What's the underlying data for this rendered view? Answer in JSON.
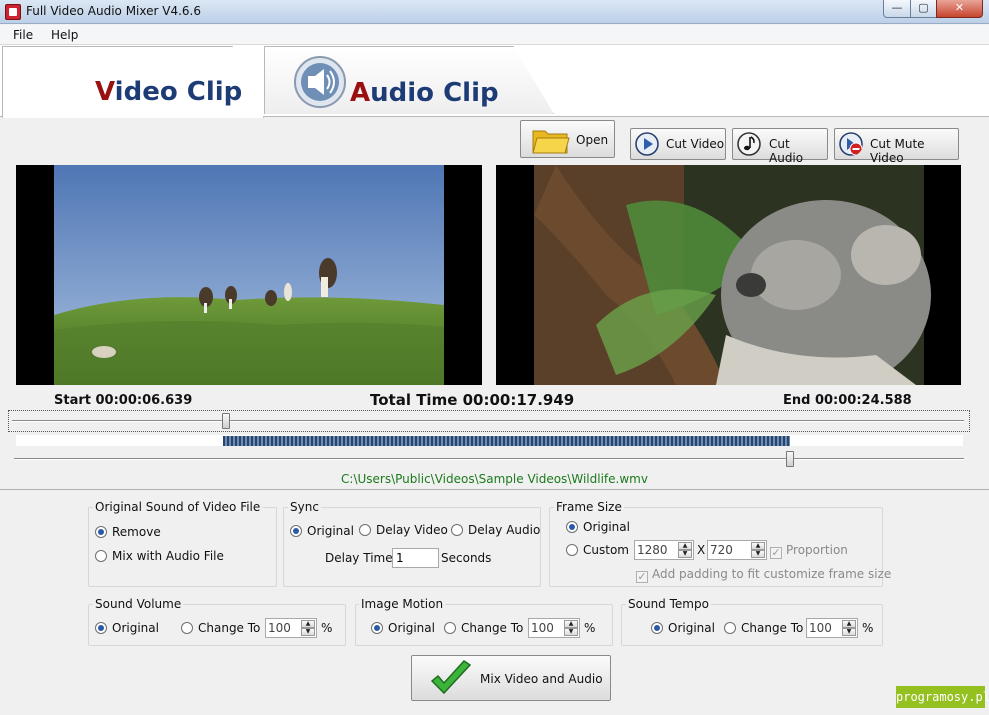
{
  "window": {
    "title": "Full Video Audio Mixer V4.6.6",
    "minimize": "—",
    "maximize": "▢",
    "close": "✕"
  },
  "menu": {
    "file": "File",
    "help": "Help"
  },
  "tabs": {
    "video": {
      "first": "V",
      "rest": "ideo Clip"
    },
    "audio": {
      "first": "A",
      "rest": "udio Clip"
    }
  },
  "toolbar": {
    "open": "Open",
    "cut_video": "Cut Video",
    "cut_audio": "Cut Audio",
    "cut_mute_video": "Cut Mute Video"
  },
  "timeline": {
    "start": "Start 00:00:06.639",
    "total": "Total Time 00:00:17.949",
    "end": "End 00:00:24.588",
    "file_path": "C:\\Users\\Public\\Videos\\Sample Videos\\Wildlife.wmv"
  },
  "original_sound": {
    "title": "Original Sound of Video File",
    "remove": "Remove",
    "mix": "Mix with Audio File"
  },
  "sync": {
    "title": "Sync",
    "original": "Original",
    "delay_video": "Delay Video",
    "delay_audio": "Delay Audio",
    "delay_time_label": "Delay Time",
    "delay_time_value": "1",
    "seconds": "Seconds"
  },
  "frame_size": {
    "title": "Frame Size",
    "original": "Original",
    "custom": "Custom",
    "width": "1280",
    "x": "X",
    "height": "720",
    "proportion": "Proportion",
    "padding": "Add padding to fit customize frame size"
  },
  "sound_volume": {
    "title": "Sound Volume",
    "original": "Original",
    "change_to": "Change To",
    "value": "100",
    "unit": "%"
  },
  "image_motion": {
    "title": "Image Motion",
    "original": "Original",
    "change_to": "Change To",
    "value": "100",
    "unit": "%"
  },
  "sound_tempo": {
    "title": "Sound Tempo",
    "original": "Original",
    "change_to": "Change To",
    "value": "100",
    "unit": "%"
  },
  "mix_button": "Mix Video and Audio",
  "watermark": "programosy.pl"
}
